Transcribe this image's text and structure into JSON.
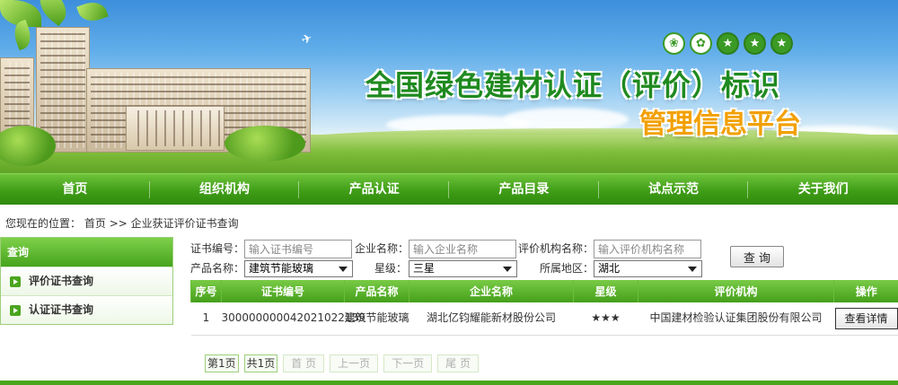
{
  "banner": {
    "title": "全国绿色建材认证（评价）标识",
    "subtitle": "管理信息平台",
    "logos": [
      "leaf-logo",
      "hand-logo",
      "grade-one-seal",
      "grade-two-seal",
      "grade-three-seal"
    ]
  },
  "nav": {
    "items": [
      {
        "label": "首页"
      },
      {
        "label": "组织机构"
      },
      {
        "label": "产品认证"
      },
      {
        "label": "产品目录"
      },
      {
        "label": "试点示范"
      },
      {
        "label": "关于我们"
      }
    ]
  },
  "breadcrumb": {
    "prefix": "您现在的位置：",
    "home": "首页",
    "separator": ">>",
    "current": "企业获证评价证书查询"
  },
  "sidebar": {
    "title": "查询",
    "items": [
      {
        "label": "评价证书查询"
      },
      {
        "label": "认证证书查询"
      }
    ]
  },
  "search": {
    "cert_no_label": "证书编号：",
    "cert_no_placeholder": "输入证书编号",
    "company_label": "企业名称：",
    "company_placeholder": "输入企业名称",
    "agency_label": "评价机构名称：",
    "agency_placeholder": "输入评价机构名称",
    "product_label": "产品名称：",
    "product_value": "建筑节能玻璃",
    "level_label": "星级：",
    "level_value": "三星",
    "region_label": "所属地区：",
    "region_value": "湖北",
    "query_button": "查 询"
  },
  "table": {
    "headers": [
      "序号",
      "证书编号",
      "产品名称",
      "企业名称",
      "星级",
      "评价机构",
      "操作"
    ],
    "rows": [
      {
        "index": "1",
        "cert_no": "300000000042021022139",
        "product": "建筑节能玻璃",
        "company": "湖北亿钧耀能新材股份公司",
        "stars": "★★★",
        "agency": "中国建材检验认证集团股份有限公司",
        "action": "查看详情"
      }
    ]
  },
  "pager": {
    "current": "第1页",
    "total": "共1页",
    "first": "首 页",
    "prev": "上一页",
    "next": "下一页",
    "last": "尾 页"
  },
  "colors": {
    "brand_green": "#3f9d17",
    "title_green": "#1f8a1f",
    "title_orange": "#f2a000"
  }
}
